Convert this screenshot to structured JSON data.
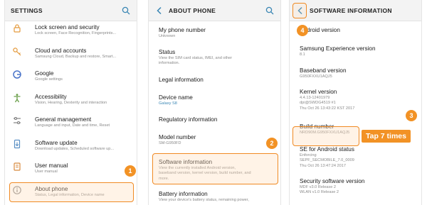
{
  "panel1": {
    "title": "SETTINGS",
    "items": [
      {
        "name": "Lock screen and security",
        "sub": "Lock screen, Face Recognition, Fingerprints..."
      },
      {
        "name": "Cloud and accounts",
        "sub": "Samsung Cloud, Backup and restore, Smart..."
      },
      {
        "name": "Google",
        "sub": "Google settings"
      },
      {
        "name": "Accessibility",
        "sub": "Vision, Hearing, Dexterity and interaction"
      },
      {
        "name": "General management",
        "sub": "Language and input, Date and time, Reset"
      },
      {
        "name": "Software update",
        "sub": "Download updates, Scheduled software up..."
      },
      {
        "name": "User manual",
        "sub": "User manual"
      },
      {
        "name": "About phone",
        "sub": "Status, Legal information, Device name"
      }
    ],
    "badge": "1"
  },
  "panel2": {
    "title": "ABOUT PHONE",
    "items": [
      {
        "name": "My phone number",
        "sub1": "Unknown"
      },
      {
        "name": "Status",
        "sub1": "View the SIM card status, IMEI, and other",
        "sub2": "information."
      },
      {
        "name": "Legal information"
      },
      {
        "name": "Device name",
        "sub1": "Galaxy S8"
      },
      {
        "name": "Regulatory information"
      },
      {
        "name": "Model number",
        "sub1": "SM-G950FD"
      },
      {
        "name": "Software information",
        "sub1": "View the currently installed Android version,",
        "sub2": "baseband version, kernel version, build number, and",
        "sub3": "more."
      },
      {
        "name": "Battery information",
        "sub1": "View your device's battery status, remaining power,"
      }
    ],
    "badge": "2"
  },
  "panel3": {
    "title": "SOFTWARE INFORMATION",
    "items": [
      {
        "name": "Android version"
      },
      {
        "name": "Samsung Experience version",
        "sub1": "8.1"
      },
      {
        "name": "Baseband version",
        "sub1": "G950FXXU1AQJ5"
      },
      {
        "name": "Kernel version",
        "sub1": "4.4.13-12401979",
        "sub2": "dpi@SWDG4519 #1",
        "sub3": "Thu Oct 26 13:43:22 KST 2017"
      },
      {
        "name": "Build number",
        "sub1": "NRD90M.G950FXXU1AQJ5"
      },
      {
        "name": "SE for Android status",
        "sub1": "Enforcing",
        "sub2": "SEPF_SECMOBILE_7.0_0009",
        "sub3": "Thu Oct 26 13:47:24 2017"
      },
      {
        "name": "Security software version",
        "sub1": "MDF v3.0 Release 2",
        "sub2": "WLAN v1.0 Release 2"
      }
    ],
    "badge_build": "3",
    "badge_back": "4",
    "tap_label": "Tap 7 times"
  },
  "colors": {
    "accent": "#f29225",
    "icon": "#e49a3c",
    "link": "#3a86b4"
  }
}
